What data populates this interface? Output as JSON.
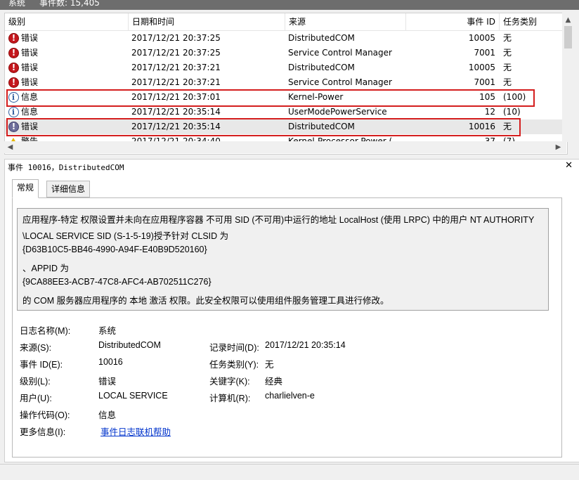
{
  "top": {
    "tab": "系统",
    "count": "事件数: 15,405"
  },
  "columns": [
    "级别",
    "日期和时间",
    "来源",
    "事件 ID",
    "任务类别"
  ],
  "events": [
    {
      "icon": "error-icon",
      "level": "错误",
      "datetime": "2017/12/21 20:37:25",
      "source": "DistributedCOM",
      "id": "10005",
      "task": "无"
    },
    {
      "icon": "error-icon",
      "level": "错误",
      "datetime": "2017/12/21 20:37:25",
      "source": "Service Control Manager",
      "id": "7001",
      "task": "无"
    },
    {
      "icon": "error-icon",
      "level": "错误",
      "datetime": "2017/12/21 20:37:21",
      "source": "DistributedCOM",
      "id": "10005",
      "task": "无"
    },
    {
      "icon": "error-icon",
      "level": "错误",
      "datetime": "2017/12/21 20:37:21",
      "source": "Service Control Manager",
      "id": "7001",
      "task": "无"
    },
    {
      "icon": "info-icon",
      "level": "信息",
      "datetime": "2017/12/21 20:37:01",
      "source": "Kernel-Power",
      "id": "105",
      "task": "(100)"
    },
    {
      "icon": "info-icon",
      "level": "信息",
      "datetime": "2017/12/21 20:35:14",
      "source": "UserModePowerService",
      "id": "12",
      "task": "(10)"
    },
    {
      "icon": "error-icon",
      "level": "错误",
      "datetime": "2017/12/21 20:35:14",
      "source": "DistributedCOM",
      "id": "10016",
      "task": "无"
    },
    {
      "icon": "warning-icon",
      "level": "警告",
      "datetime": "2017/12/21 20:34:40",
      "source": "Kernel-Processor-Power (",
      "id": "37",
      "task": "(7)"
    }
  ],
  "detail": {
    "title": "事件 10016，DistributedCOM",
    "close": "✕",
    "tabs": [
      "常规",
      "详细信息"
    ],
    "description": [
      "应用程序-特定 权限设置并未向在应用程序容器 不可用 SID (不可用)中运行的地址 LocalHost (使用 LRPC) 中的用户 NT AUTHORITY",
      "\\LOCAL SERVICE SID (S-1-5-19)授予针对 CLSID 为",
      "{D63B10C5-BB46-4990-A94F-E40B9D520160}",
      "、APPID 为",
      "{9CA88EE3-ACB7-47C8-AFC4-AB702511C276}",
      " 的 COM 服务器应用程序的 本地 激活 权限。此安全权限可以使用组件服务管理工具进行修改。"
    ],
    "fields": {
      "log_name_label": "日志名称(M):",
      "log_name": "系统",
      "source_label": "来源(S):",
      "source": "DistributedCOM",
      "logged_label": "记录时间(D):",
      "logged": "2017/12/21 20:35:14",
      "event_id_label": "事件 ID(E):",
      "event_id": "10016",
      "task_label": "任务类别(Y):",
      "task": "无",
      "level_label": "级别(L):",
      "level": "错误",
      "keywords_label": "关键字(K):",
      "keywords": "经典",
      "user_label": "用户(U):",
      "user": "LOCAL SERVICE",
      "computer_label": "计算机(R):",
      "computer": "charlielven-e",
      "opcode_label": "操作代码(O):",
      "opcode": "信息",
      "more_info_label": "更多信息(I):",
      "more_info_link": "事件日志联机帮助"
    }
  }
}
